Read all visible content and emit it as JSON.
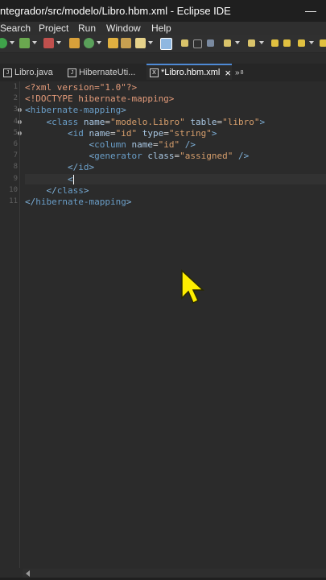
{
  "window": {
    "title": "ntegrador/src/modelo/Libro.hbm.xml - Eclipse IDE",
    "minimize_glyph": "—"
  },
  "menu": {
    "items": [
      "Search",
      "Project",
      "Run",
      "Window",
      "Help"
    ]
  },
  "toolbar": {
    "icons": [
      "run-icon",
      "debug-icon",
      "external-tools-icon",
      "new-icon",
      "refresh-icon",
      "open-folder-icon",
      "open-type-icon",
      "pencil-icon",
      "highlight-icon",
      "toggle-mark-icon",
      "block-selection-icon",
      "show-whitespace-icon",
      "next-annotation-icon",
      "prev-annotation-icon",
      "back-icon",
      "forward-icon"
    ]
  },
  "tabs": [
    {
      "label": "Libro.java",
      "icon": "java-file-icon",
      "active": false
    },
    {
      "label": "HibernateUti...",
      "icon": "java-file-icon",
      "active": false
    },
    {
      "label": "*Libro.hbm.xml",
      "icon": "xml-file-icon",
      "active": true,
      "close": "×"
    },
    {
      "label": "»",
      "overflow_count": "8",
      "active": false
    }
  ],
  "editor": {
    "lines": [
      {
        "n": "1",
        "tokens": [
          [
            "pi",
            "<?xml version=\"1.0\"?>"
          ]
        ]
      },
      {
        "n": "2",
        "tokens": [
          [
            "pi",
            "<!DOCTYPE hibernate-mapping>"
          ]
        ]
      },
      {
        "n": "3",
        "tokens": [
          [
            "bracket",
            "<"
          ],
          [
            "tag",
            "hibernate-mapping"
          ],
          [
            "bracket",
            ">"
          ]
        ]
      },
      {
        "n": "4",
        "tokens": [
          [
            "text",
            "    "
          ],
          [
            "bracket",
            "<"
          ],
          [
            "tag",
            "class"
          ],
          [
            "text",
            " "
          ],
          [
            "attr",
            "name"
          ],
          [
            "text",
            "="
          ],
          [
            "val",
            "\"modelo.Libro\""
          ],
          [
            "text",
            " "
          ],
          [
            "attr",
            "table"
          ],
          [
            "text",
            "="
          ],
          [
            "val",
            "\"libro\""
          ],
          [
            "bracket",
            ">"
          ]
        ]
      },
      {
        "n": "5",
        "tokens": [
          [
            "text",
            "        "
          ],
          [
            "bracket",
            "<"
          ],
          [
            "tag",
            "id"
          ],
          [
            "text",
            " "
          ],
          [
            "attr",
            "name"
          ],
          [
            "text",
            "="
          ],
          [
            "val",
            "\"id\""
          ],
          [
            "text",
            " "
          ],
          [
            "attr",
            "type"
          ],
          [
            "text",
            "="
          ],
          [
            "val",
            "\"string\""
          ],
          [
            "bracket",
            ">"
          ]
        ]
      },
      {
        "n": "6",
        "tokens": [
          [
            "text",
            "            "
          ],
          [
            "bracket",
            "<"
          ],
          [
            "tag",
            "column"
          ],
          [
            "text",
            " "
          ],
          [
            "attr",
            "name"
          ],
          [
            "text",
            "="
          ],
          [
            "val",
            "\"id\""
          ],
          [
            "text",
            " "
          ],
          [
            "bracket",
            "/>"
          ]
        ]
      },
      {
        "n": "7",
        "tokens": [
          [
            "text",
            "            "
          ],
          [
            "bracket",
            "<"
          ],
          [
            "tag",
            "generator"
          ],
          [
            "text",
            " "
          ],
          [
            "attr",
            "class"
          ],
          [
            "text",
            "="
          ],
          [
            "val",
            "\"assigned\""
          ],
          [
            "text",
            " "
          ],
          [
            "bracket",
            "/>"
          ]
        ]
      },
      {
        "n": "8",
        "tokens": [
          [
            "text",
            "        "
          ],
          [
            "bracket",
            "</"
          ],
          [
            "tag",
            "id"
          ],
          [
            "bracket",
            ">"
          ]
        ]
      },
      {
        "n": "9",
        "tokens": [
          [
            "text",
            "        "
          ],
          [
            "bracket",
            "<"
          ]
        ]
      },
      {
        "n": "10",
        "tokens": [
          [
            "text",
            "    "
          ],
          [
            "bracket",
            "</"
          ],
          [
            "tag",
            "class"
          ],
          [
            "bracket",
            ">"
          ]
        ]
      },
      {
        "n": "11",
        "tokens": [
          [
            "bracket",
            "</"
          ],
          [
            "tag",
            "hibernate-mapping"
          ],
          [
            "bracket",
            ">"
          ]
        ]
      }
    ],
    "fold_lines": [
      3,
      4,
      5
    ],
    "cursor_line": 9
  },
  "colors": {
    "editor_bg": "#2b2b2b",
    "tag": "#6a9ec8",
    "attribute": "#a9c7e3",
    "value": "#d69e6c",
    "processing_instruction": "#e39b7a",
    "pointer": "#ffee00"
  }
}
